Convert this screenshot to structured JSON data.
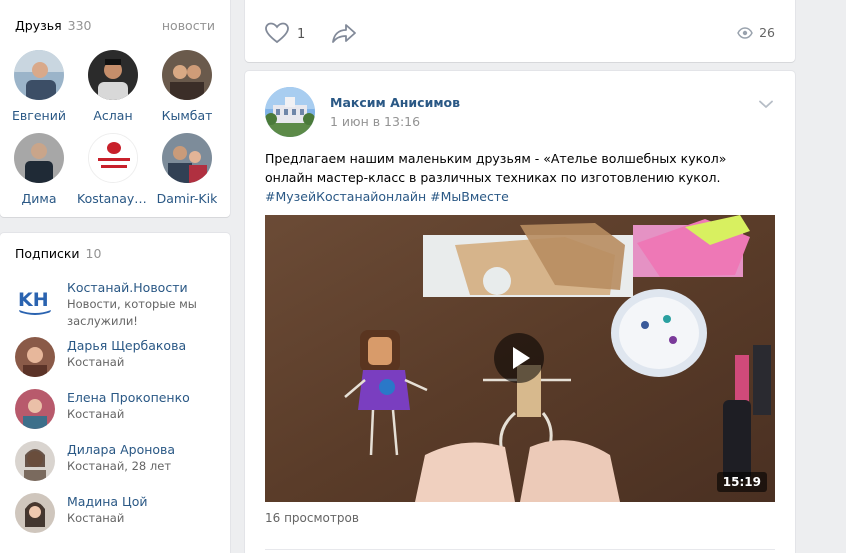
{
  "friends": {
    "title": "Друзья",
    "count": "330",
    "link": "новости",
    "items": [
      {
        "name": "Евгений"
      },
      {
        "name": "Аслан"
      },
      {
        "name": "Кымбат"
      },
      {
        "name": "Дима"
      },
      {
        "name": "Kostanays..."
      },
      {
        "name": "Damir-Kik"
      }
    ]
  },
  "subscriptions": {
    "title": "Подписки",
    "count": "10",
    "items": [
      {
        "name": "Костанай.Новости",
        "desc": "Новости, которые мы заслужили!"
      },
      {
        "name": "Дарья Щербакова",
        "desc": "Костанай"
      },
      {
        "name": "Елена Прокопенко",
        "desc": "Костанай"
      },
      {
        "name": "Дилара Аронова",
        "desc": "Костанай, 28 лет"
      },
      {
        "name": "Мадина Цой",
        "desc": "Костанай"
      }
    ]
  },
  "prev_post": {
    "likes": "1",
    "views": "26"
  },
  "post": {
    "author": "Максим Анисимов",
    "date": "1 июн в 13:16",
    "text": "Предлагаем нашим маленьким друзьям - «Ателье волшебных кукол» онлайн мастер-класс в различных техниках по изготовлению кукол.",
    "hashtags": [
      "#МузейКостанайонлайн",
      "#МыВместе"
    ],
    "video_duration": "15:19",
    "views_text": "16 просмотров"
  },
  "icons": {
    "like": "heart-icon",
    "share": "share-arrow-icon",
    "views": "eye-icon",
    "menu": "chevron-down-icon",
    "play": "play-icon"
  },
  "colors": {
    "link": "#2a5885",
    "background": "#edeef0",
    "muted": "#939393"
  }
}
